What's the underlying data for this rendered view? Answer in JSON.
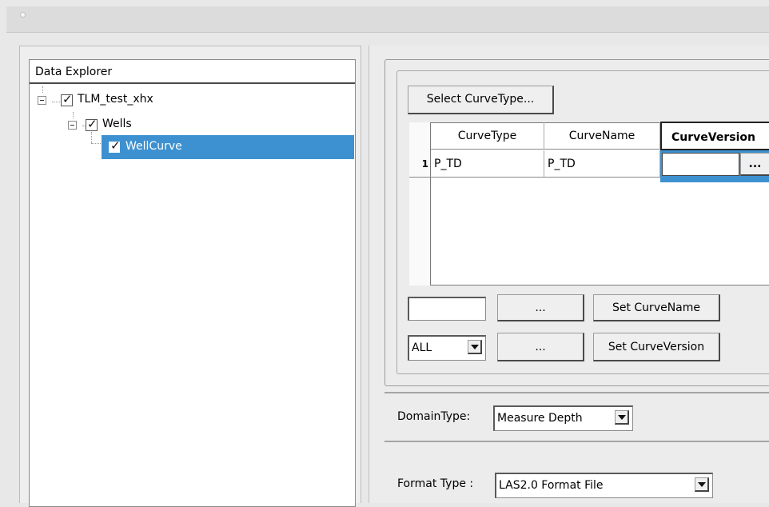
{
  "data_explorer": {
    "title": "Data Explorer",
    "tree": [
      {
        "label": "TLM_test_xhx",
        "checked": true
      },
      {
        "label": "Wells",
        "checked": true
      },
      {
        "label": "WellCurve",
        "checked": true,
        "selected": true
      }
    ]
  },
  "curve_panel": {
    "select_button_label": "Select CurveType...",
    "table": {
      "columns": [
        "CurveType",
        "CurveName",
        "CurveVersion"
      ],
      "rows": [
        {
          "index": "1",
          "curve_type": "P_TD",
          "curve_name": "P_TD",
          "curve_version": ""
        }
      ],
      "ellipsis_label": "..."
    },
    "name_input_value": "",
    "name_browse_label": "...",
    "set_name_label": "Set  CurveName",
    "version_combo_value": "ALL",
    "version_browse_label": "...",
    "set_version_label": "Set CurveVersion"
  },
  "domain": {
    "label": "DomainType:",
    "value": "Measure  Depth"
  },
  "format": {
    "label": "Format Type :",
    "value": "LAS2.0 Format File"
  },
  "colors": {
    "selection": "#3d91d0",
    "background": "#e8e8e8"
  }
}
